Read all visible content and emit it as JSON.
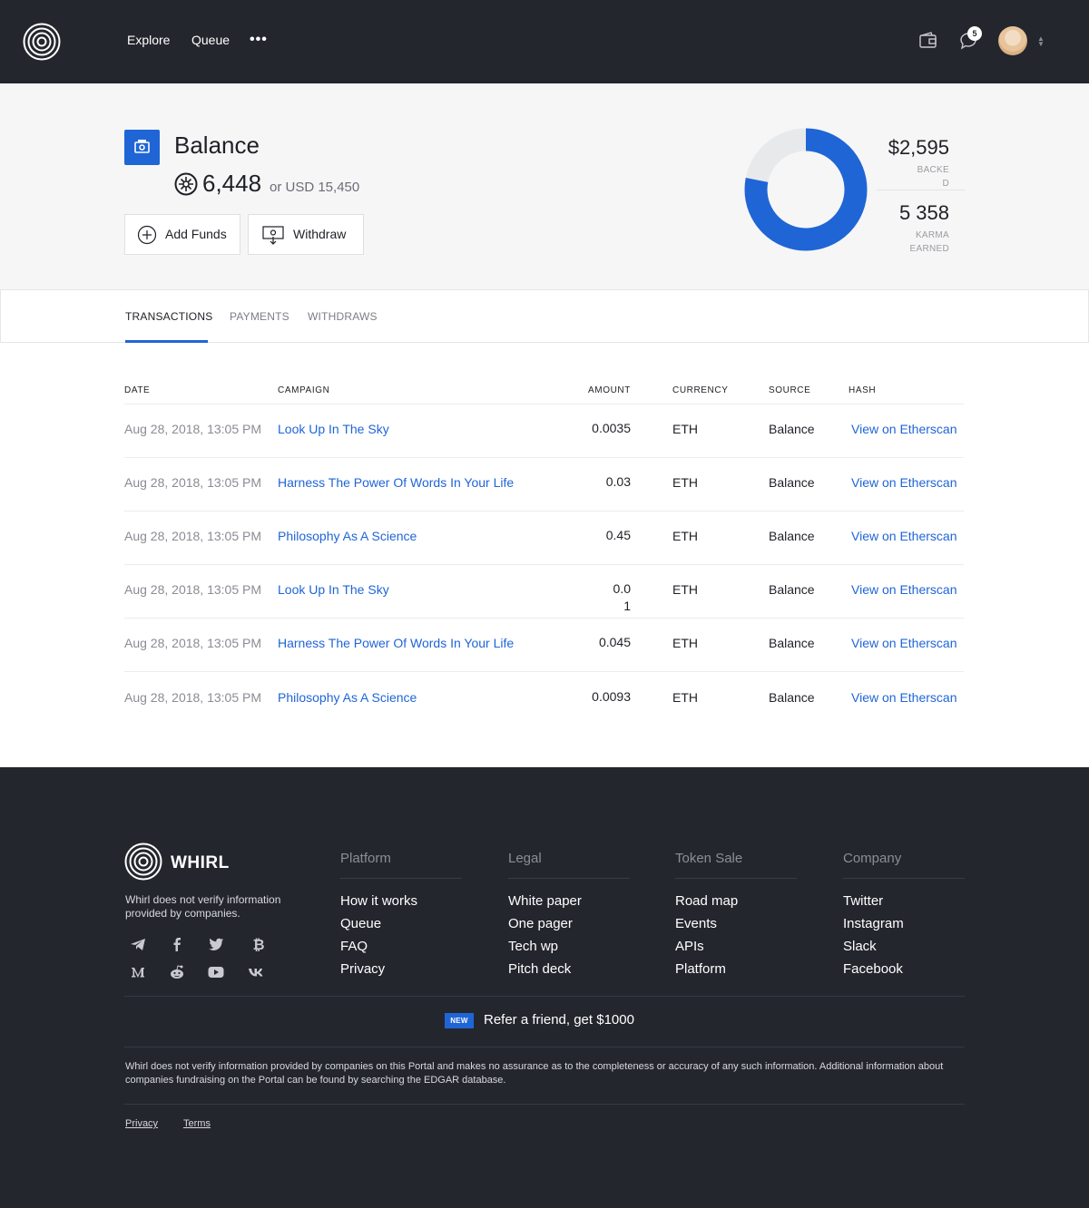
{
  "header": {
    "nav": [
      "Explore",
      "Queue"
    ],
    "more": "•••",
    "notification_count": "5"
  },
  "balance": {
    "title": "Balance",
    "amount": "6,448",
    "usd": "or USD 15,450",
    "add_funds": "Add Funds",
    "withdraw": "Withdraw"
  },
  "stats": {
    "backed_value": "$2,595",
    "backed_label_1": "BACKE",
    "backed_label_2": "D",
    "karma_value": "5 358",
    "karma_label_1": "KARMA",
    "karma_label_2": "EARNED",
    "donut_fraction": 0.78,
    "accent_color": "#1f65d6"
  },
  "tabs": [
    "TRANSACTIONS",
    "PAYMENTS",
    "WITHDRAWS"
  ],
  "table": {
    "headers": [
      "DATE",
      "CAMPAIGN",
      "AMOUNT",
      "CURRENCY",
      "SOURCE",
      "HASH"
    ],
    "rows": [
      {
        "date": "Aug 28, 2018, 13:05 PM",
        "campaign": "Look Up In The Sky",
        "amount": "0.0035",
        "currency": "ETH",
        "source": "Balance",
        "hash": "View on Etherscan"
      },
      {
        "date": "Aug 28, 2018, 13:05 PM",
        "campaign": "Harness The Power Of Words In Your Life",
        "amount": "0.03",
        "currency": "ETH",
        "source": "Balance",
        "hash": "View on Etherscan"
      },
      {
        "date": "Aug 28, 2018, 13:05 PM",
        "campaign": "Philosophy As A Science",
        "amount": "0.45",
        "currency": "ETH",
        "source": "Balance",
        "hash": "View on Etherscan"
      },
      {
        "date": "Aug 28, 2018, 13:05 PM",
        "campaign": "Look Up In The Sky",
        "amount": "0.0\n1",
        "currency": "ETH",
        "source": "Balance",
        "hash": "View on Etherscan"
      },
      {
        "date": "Aug 28, 2018, 13:05 PM",
        "campaign": "Harness The Power Of Words In Your Life",
        "amount": "0.045",
        "currency": "ETH",
        "source": "Balance",
        "hash": "View on Etherscan"
      },
      {
        "date": "Aug 28, 2018, 13:05 PM",
        "campaign": "Philosophy As A Science",
        "amount": "0.0093",
        "currency": "ETH",
        "source": "Balance",
        "hash": "View on Etherscan"
      }
    ]
  },
  "footer": {
    "brand": "WHIRL",
    "note": "Whirl does not verify information provided by companies.",
    "social_icons": [
      "telegram-icon",
      "facebook-icon",
      "twitter-icon",
      "bitcoin-icon",
      "medium-icon",
      "reddit-icon",
      "youtube-icon",
      "vk-icon"
    ],
    "columns": [
      {
        "title": "Platform",
        "items": [
          "How it works",
          "Queue",
          "FAQ",
          "Privacy"
        ]
      },
      {
        "title": "Legal",
        "items": [
          "White paper",
          "One pager",
          "Tech wp",
          "Pitch deck"
        ]
      },
      {
        "title": "Token Sale",
        "items": [
          "Road map",
          "Events",
          "APIs",
          "Platform"
        ]
      },
      {
        "title": "Company",
        "items": [
          "Twitter",
          "Instagram",
          "Slack",
          "Facebook"
        ]
      }
    ],
    "new_badge": "NEW",
    "refer": "Refer a friend, get $1000",
    "disclaimer": "Whirl does not verify information provided by companies on this Portal and makes no assurance as to the completeness or accuracy of any such information. Additional information about companies fundraising on the Portal can be found by searching the EDGAR database.",
    "links": [
      "Privacy",
      "Terms"
    ]
  }
}
